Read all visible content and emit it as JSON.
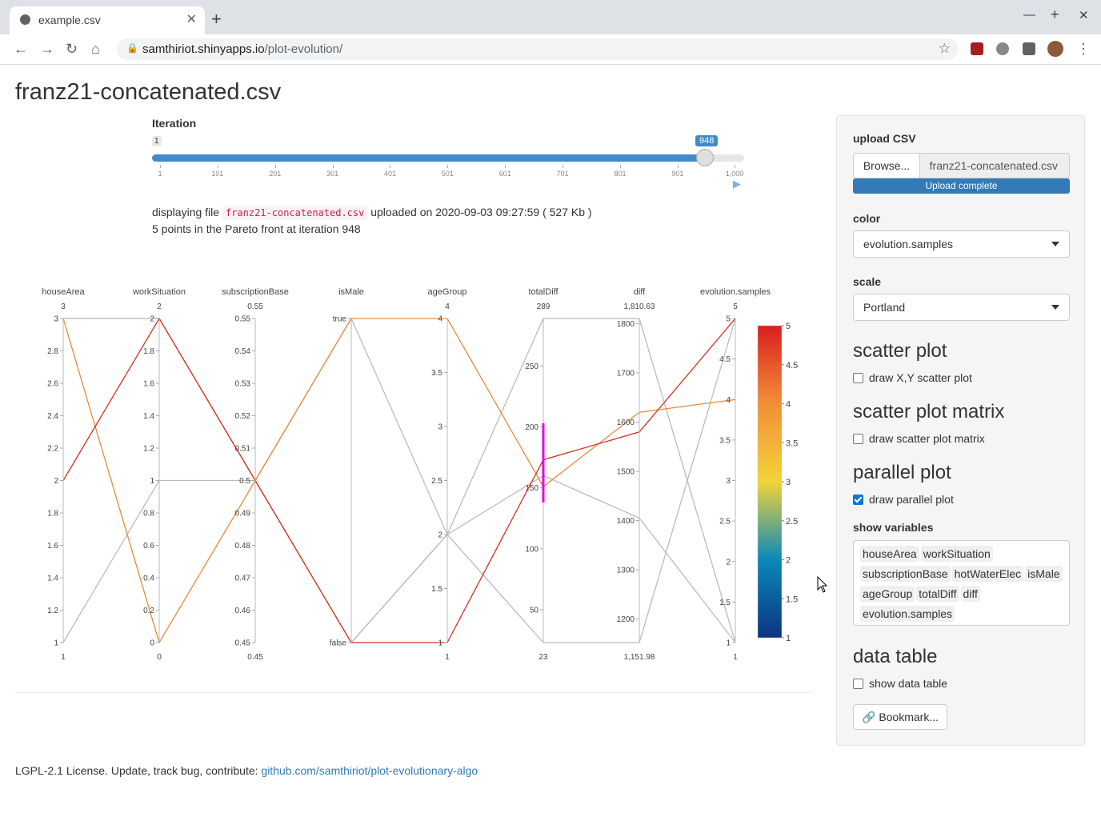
{
  "browser": {
    "tab_title": "example.csv",
    "url_host": "samthiriot.shinyapps.io",
    "url_path": "/plot-evolution/"
  },
  "page": {
    "title": "franz21-concatenated.csv",
    "slider": {
      "label": "Iteration",
      "min_label": "1",
      "value_label": "948",
      "value": 948,
      "min": 1,
      "max": 1000,
      "ticks": [
        "1",
        "101",
        "201",
        "301",
        "401",
        "501",
        "601",
        "701",
        "801",
        "901",
        "1,000"
      ]
    },
    "info": {
      "prefix": "displaying file",
      "filename": "franz21-concatenated.csv",
      "suffix": "uploaded on 2020-09-03 09:27:59 ( 527 Kb )",
      "pareto": "5 points in the Pareto front at iteration 948"
    },
    "footer": {
      "text": "LGPL-2.1 License. Update, track bug, contribute:",
      "link": "github.com/samthiriot/plot-evolutionary-algo"
    }
  },
  "sidebar": {
    "upload_label": "upload CSV",
    "browse_label": "Browse...",
    "file_value": "franz21-concatenated.csv",
    "progress_label": "Upload complete",
    "color_label": "color",
    "color_value": "evolution.samples",
    "scale_label": "scale",
    "scale_value": "Portland",
    "scatter_heading": "scatter plot",
    "scatter_check": "draw X,Y scatter plot",
    "matrix_heading": "scatter plot matrix",
    "matrix_check": "draw scatter plot matrix",
    "parallel_heading": "parallel plot",
    "parallel_check": "draw parallel plot",
    "show_vars_label": "show variables",
    "variables": [
      "houseArea",
      "workSituation",
      "subscriptionBase",
      "hotWaterElec",
      "isMale",
      "ageGroup",
      "totalDiff",
      "diff",
      "evolution.samples"
    ],
    "table_heading": "data table",
    "table_check": "show data table",
    "bookmark_label": "Bookmark..."
  },
  "chart_data": {
    "type": "parallel",
    "axes": [
      {
        "name": "houseArea",
        "top": "3",
        "bottom": "1",
        "range": [
          1,
          3
        ],
        "ticks": [
          "1",
          "1.2",
          "1.4",
          "1.6",
          "1.8",
          "2",
          "2.2",
          "2.4",
          "2.6",
          "2.8",
          "3"
        ]
      },
      {
        "name": "workSituation",
        "top": "2",
        "bottom": "0",
        "range": [
          0,
          2
        ],
        "ticks": [
          "0",
          "0.2",
          "0.4",
          "0.6",
          "0.8",
          "1",
          "1.2",
          "1.4",
          "1.6",
          "1.8",
          "2"
        ]
      },
      {
        "name": "subscriptionBase",
        "top": "0.55",
        "bottom": "0.45",
        "range": [
          0.45,
          0.55
        ],
        "ticks": [
          "0.45",
          "0.46",
          "0.47",
          "0.48",
          "0.49",
          "0.5",
          "0.51",
          "0.52",
          "0.53",
          "0.54",
          "0.55"
        ]
      },
      {
        "name": "isMale",
        "top": "",
        "bottom": "",
        "range": [
          0,
          1
        ],
        "ticks": [
          "false",
          "true"
        ]
      },
      {
        "name": "ageGroup",
        "top": "4",
        "bottom": "1",
        "range": [
          1,
          4
        ],
        "ticks": [
          "1",
          "1.5",
          "2",
          "2.5",
          "3",
          "3.5",
          "4"
        ]
      },
      {
        "name": "totalDiff",
        "top": "289",
        "bottom": "23",
        "range": [
          23,
          289
        ],
        "ticks": [
          "50",
          "100",
          "150",
          "200",
          "250"
        ]
      },
      {
        "name": "diff",
        "top": "1,810.63",
        "bottom": "1,151.98",
        "range": [
          1151.98,
          1810.63
        ],
        "ticks": [
          "1200",
          "1300",
          "1400",
          "1500",
          "1600",
          "1700",
          "1800"
        ]
      },
      {
        "name": "evolution.samples",
        "top": "5",
        "bottom": "1",
        "range": [
          1,
          5
        ],
        "ticks": [
          "1",
          "1.5",
          "2",
          "2.5",
          "3",
          "3.5",
          "4",
          "4.5",
          "5"
        ]
      }
    ],
    "lines": [
      {
        "values": [
          2,
          2,
          0.5,
          0,
          1,
          173,
          1580,
          5
        ],
        "color": "#d7301f"
      },
      {
        "values": [
          3,
          0,
          0.5,
          1,
          4,
          151,
          1620,
          4
        ],
        "color": "#e88a3a"
      },
      {
        "values": [
          1,
          1,
          0.5,
          0,
          2,
          160,
          1405,
          1
        ],
        "color": "#bbbbbb"
      },
      {
        "values": [
          3,
          2,
          0.5,
          1,
          2,
          289,
          1810.63,
          1
        ],
        "color": "#bbbbbb"
      },
      {
        "values": [
          3,
          2,
          0.5,
          0,
          2,
          23,
          1151.98,
          5
        ],
        "color": "#bbbbbb"
      }
    ],
    "colorbar": {
      "range": [
        1,
        5
      ],
      "ticks": [
        "1",
        "1.5",
        "2",
        "2.5",
        "3",
        "3.5",
        "4",
        "4.5",
        "5"
      ]
    },
    "brush": {
      "axis": "totalDiff",
      "range": [
        138,
        203
      ],
      "color": "#e600e6"
    }
  }
}
